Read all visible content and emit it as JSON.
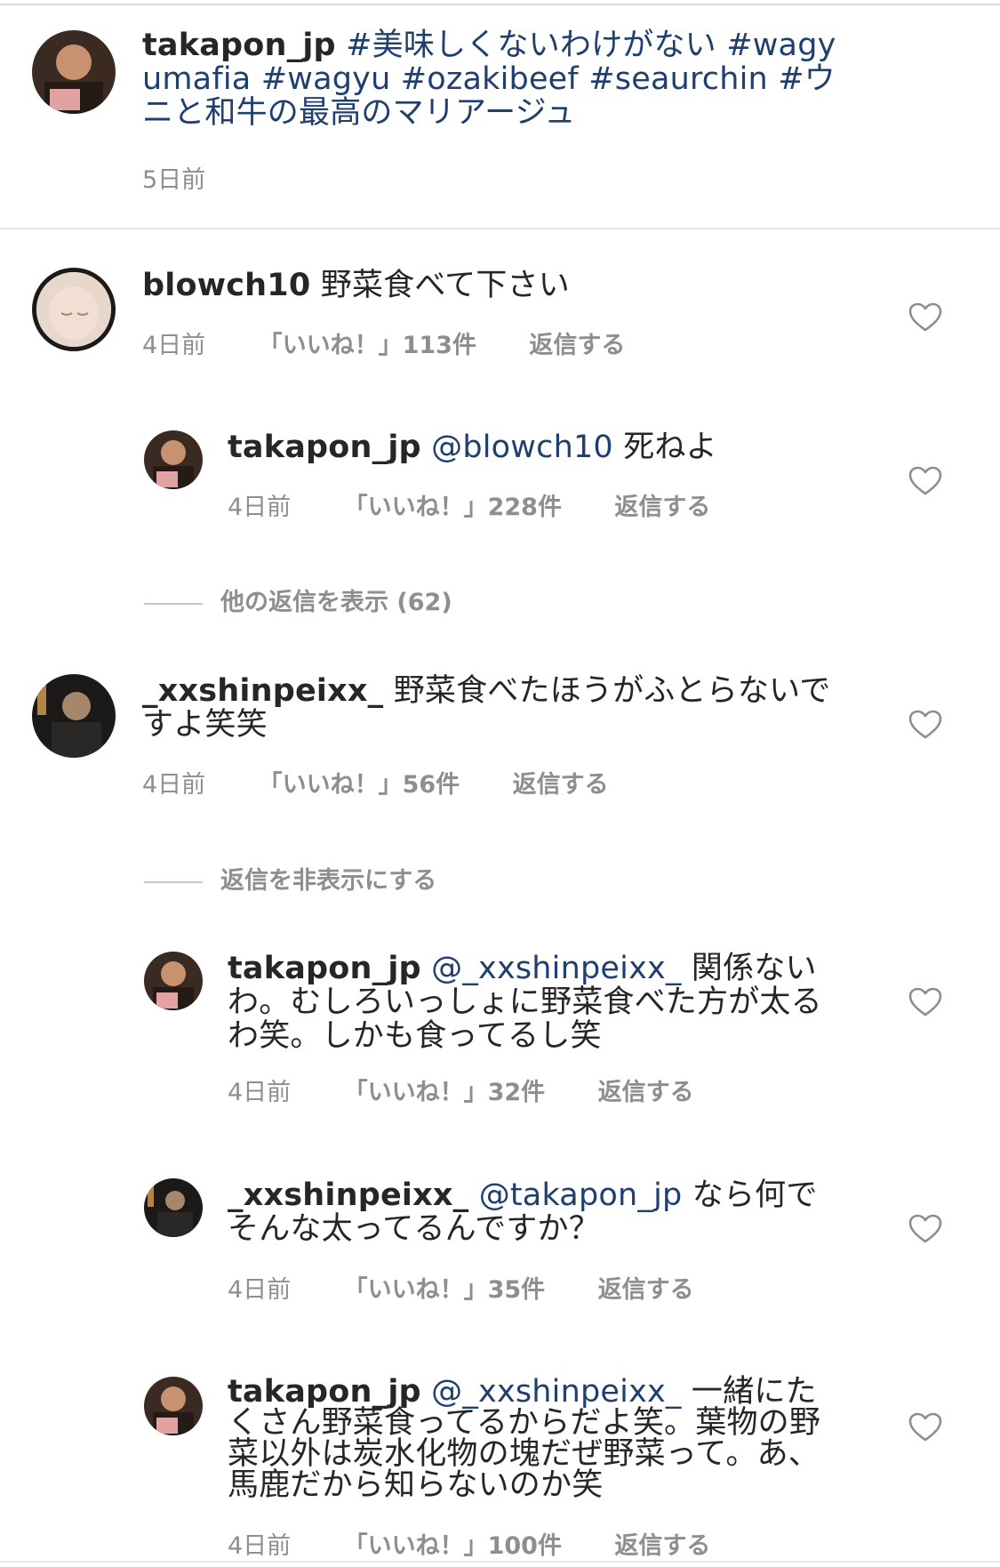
{
  "caption": {
    "username": "takapon_jp",
    "text": "#美味しくないわけがない #wagyumafia #wagyu #ozakibeef #seaurchin #ウニと和牛の最高のマリアージュ",
    "time": "5日前"
  },
  "comments": [
    {
      "username": "blowch10",
      "mention": "",
      "text": "野菜食べて下さい",
      "time": "4日前",
      "likes": "「いいね！」113件",
      "reply": "返信する"
    },
    {
      "username": "takapon_jp",
      "mention": "@blowch10",
      "text": "死ねよ",
      "time": "4日前",
      "likes": "「いいね！」228件",
      "reply": "返信する"
    },
    {
      "username": "_xxshinpeixx_",
      "mention": "",
      "text": "野菜食べたほうがふとらないですよ笑笑",
      "time": "4日前",
      "likes": "「いいね！」56件",
      "reply": "返信する"
    },
    {
      "username": "takapon_jp",
      "mention": "@_xxshinpeixx_",
      "text": "関係ないわ。むしろいっしょに野菜食べた方が太るわ笑。しかも食ってるし笑",
      "time": "4日前",
      "likes": "「いいね！」32件",
      "reply": "返信する"
    },
    {
      "username": "_xxshinpeixx_",
      "mention": "@takapon_jp",
      "text": "なら何でそんな太ってるんですか？",
      "time": "4日前",
      "likes": "「いいね！」35件",
      "reply": "返信する"
    },
    {
      "username": "takapon_jp",
      "mention": "@_xxshinpeixx_",
      "text": "一緒にたくさん野菜食ってるからだよ笑。葉物の野菜以外は炭水化物の塊だぜ野菜って。あ、馬鹿だから知らないのか笑",
      "time": "4日前",
      "likes": "「いいね！」100件",
      "reply": "返信する"
    }
  ],
  "toggles": {
    "show_more": "他の返信を表示 (62)",
    "hide_replies": "返信を非表示にする"
  },
  "icons": {
    "like": "heart-outline-icon"
  },
  "colors": {
    "link": "#1f3f6e",
    "meta": "#8e8e8e",
    "text": "#262626"
  }
}
